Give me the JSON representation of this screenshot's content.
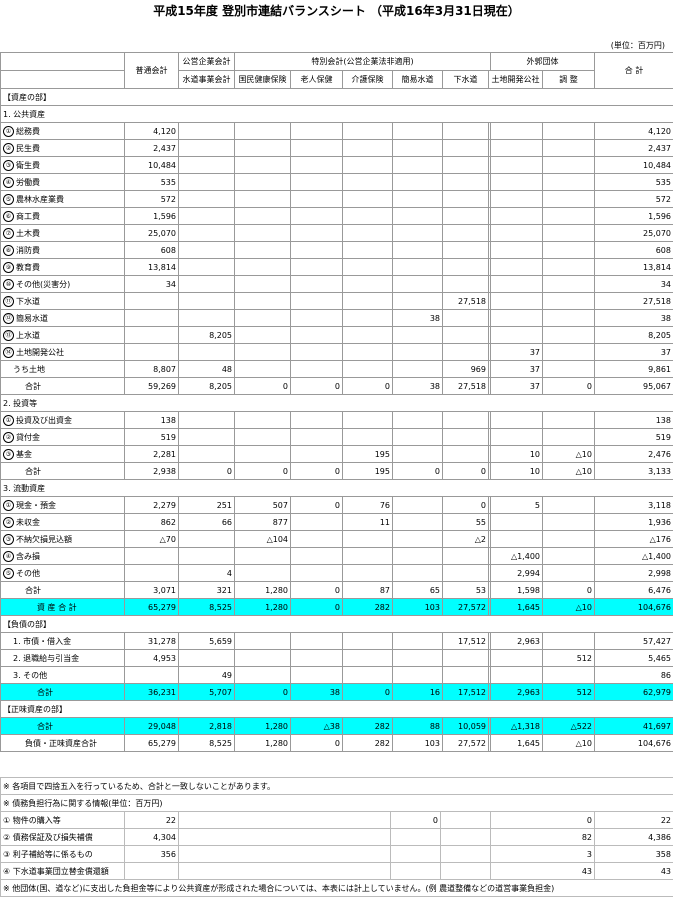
{
  "title": "平成15年度 登別市連結バランスシート （平成16年3月31日現在）",
  "unit": "(単位：百万円)",
  "headers": {
    "group_kouei": "公営企業会計",
    "group_tokubetsu": "特別会計(公営企業法非適用)",
    "group_gaibu": "外郭団体",
    "ippan": "普通会計",
    "suido": "水道事業会計",
    "kokuho": "国民健康保険",
    "rojin": "老人保健",
    "kaigo": "介護保険",
    "kani": "簡易水道",
    "gesui": "下水道",
    "tochi": "土地開発公社",
    "chosei": "調 整",
    "total": "合 計"
  },
  "rows": [
    {
      "type": "section",
      "label": "【資産の部】"
    },
    {
      "type": "section",
      "label": "1. 公共資産"
    },
    {
      "type": "item",
      "num": "①",
      "label": "総務費",
      "v": [
        "4,120",
        "",
        "",
        "",
        "",
        "",
        "",
        "",
        "",
        "",
        "4,120"
      ]
    },
    {
      "type": "item",
      "num": "②",
      "label": "民生費",
      "v": [
        "2,437",
        "",
        "",
        "",
        "",
        "",
        "",
        "",
        "",
        "",
        "2,437"
      ]
    },
    {
      "type": "item",
      "num": "③",
      "label": "衛生費",
      "v": [
        "10,484",
        "",
        "",
        "",
        "",
        "",
        "",
        "",
        "",
        "",
        "10,484"
      ]
    },
    {
      "type": "item",
      "num": "④",
      "label": "労働費",
      "v": [
        "535",
        "",
        "",
        "",
        "",
        "",
        "",
        "",
        "",
        "",
        "535"
      ]
    },
    {
      "type": "item",
      "num": "⑤",
      "label": "農林水産業費",
      "v": [
        "572",
        "",
        "",
        "",
        "",
        "",
        "",
        "",
        "",
        "",
        "572"
      ]
    },
    {
      "type": "item",
      "num": "⑥",
      "label": "商工費",
      "v": [
        "1,596",
        "",
        "",
        "",
        "",
        "",
        "",
        "",
        "",
        "",
        "1,596"
      ]
    },
    {
      "type": "item",
      "num": "⑦",
      "label": "土木費",
      "v": [
        "25,070",
        "",
        "",
        "",
        "",
        "",
        "",
        "",
        "",
        "",
        "25,070"
      ]
    },
    {
      "type": "item",
      "num": "⑧",
      "label": "消防費",
      "v": [
        "608",
        "",
        "",
        "",
        "",
        "",
        "",
        "",
        "",
        "",
        "608"
      ]
    },
    {
      "type": "item",
      "num": "⑨",
      "label": "教育費",
      "v": [
        "13,814",
        "",
        "",
        "",
        "",
        "",
        "",
        "",
        "",
        "",
        "13,814"
      ]
    },
    {
      "type": "item",
      "num": "⑩",
      "label": "その他(災害分)",
      "v": [
        "34",
        "",
        "",
        "",
        "",
        "",
        "",
        "",
        "",
        "",
        "34"
      ]
    },
    {
      "type": "item",
      "num": "⑪",
      "label": "下水道",
      "v": [
        "",
        "",
        "",
        "",
        "",
        "",
        "27,518",
        "",
        "",
        "",
        "27,518"
      ]
    },
    {
      "type": "item",
      "num": "⑫",
      "label": "簡易水道",
      "v": [
        "",
        "",
        "",
        "",
        "",
        "38",
        "",
        "",
        "",
        "",
        "38"
      ]
    },
    {
      "type": "item",
      "num": "⑬",
      "label": "上水道",
      "v": [
        "",
        "8,205",
        "",
        "",
        "",
        "",
        "",
        "",
        "",
        "",
        "8,205"
      ]
    },
    {
      "type": "item",
      "num": "⑭",
      "label": "土地開発公社",
      "v": [
        "",
        "",
        "",
        "",
        "",
        "",
        "",
        "",
        "37",
        "",
        "37"
      ]
    },
    {
      "type": "item",
      "num": "",
      "label": "うち土地",
      "v": [
        "8,807",
        "48",
        "",
        "",
        "",
        "",
        "969",
        "",
        "37",
        "",
        "9,861"
      ]
    },
    {
      "type": "sum",
      "label": "合計",
      "v": [
        "59,269",
        "8,205",
        "0",
        "0",
        "0",
        "38",
        "27,518",
        "",
        "37",
        "0",
        "95,067"
      ]
    },
    {
      "type": "section",
      "label": "2. 投資等"
    },
    {
      "type": "item",
      "num": "①",
      "label": "投資及び出資金",
      "v": [
        "138",
        "",
        "",
        "",
        "",
        "",
        "",
        "",
        "",
        "",
        "138"
      ]
    },
    {
      "type": "item",
      "num": "②",
      "label": "貸付金",
      "v": [
        "519",
        "",
        "",
        "",
        "",
        "",
        "",
        "",
        "",
        "",
        "519"
      ]
    },
    {
      "type": "item",
      "num": "③",
      "label": "基金",
      "v": [
        "2,281",
        "",
        "",
        "",
        "195",
        "",
        "",
        "",
        "10",
        "△10",
        "2,476"
      ]
    },
    {
      "type": "sum",
      "label": "合計",
      "v": [
        "2,938",
        "0",
        "0",
        "0",
        "195",
        "0",
        "0",
        "",
        "10",
        "△10",
        "3,133"
      ]
    },
    {
      "type": "section",
      "label": "3. 流動資産"
    },
    {
      "type": "item",
      "num": "①",
      "label": "現金・預金",
      "v": [
        "2,279",
        "251",
        "507",
        "0",
        "76",
        "",
        "0",
        "",
        "5",
        "",
        "3,118"
      ]
    },
    {
      "type": "item",
      "num": "②",
      "label": "未収金",
      "v": [
        "862",
        "66",
        "877",
        "",
        "11",
        "",
        "55",
        "",
        "",
        "",
        "1,936"
      ]
    },
    {
      "type": "item",
      "num": "③",
      "label": "不納欠損見込額",
      "v": [
        "△70",
        "",
        "△104",
        "",
        "",
        "",
        "△2",
        "",
        "",
        "",
        "△176"
      ]
    },
    {
      "type": "item",
      "num": "④",
      "label": "含み損",
      "v": [
        "",
        "",
        "",
        "",
        "",
        "",
        "",
        "",
        "△1,400",
        "",
        "△1,400"
      ]
    },
    {
      "type": "item",
      "num": "⑤",
      "label": "その他",
      "v": [
        "",
        "4",
        "",
        "",
        "",
        "",
        "",
        "",
        "2,994",
        "",
        "2,998"
      ]
    },
    {
      "type": "sum",
      "label": "合計",
      "v": [
        "3,071",
        "321",
        "1,280",
        "0",
        "87",
        "65",
        "53",
        "",
        "1,598",
        "0",
        "6,476"
      ]
    },
    {
      "type": "cyan",
      "label": "資 産 合 計",
      "v": [
        "65,279",
        "8,525",
        "1,280",
        "0",
        "282",
        "103",
        "27,572",
        "",
        "1,645",
        "△10",
        "104,676"
      ]
    },
    {
      "type": "section",
      "label": "【負債の部】"
    },
    {
      "type": "item",
      "num": "",
      "label": "1. 市債・借入金",
      "v": [
        "31,278",
        "5,659",
        "",
        "",
        "",
        "",
        "17,512",
        "",
        "2,963",
        "",
        "57,427"
      ]
    },
    {
      "type": "item",
      "num": "",
      "label": "2. 退職給与引当金",
      "v": [
        "4,953",
        "",
        "",
        "",
        "",
        "",
        "",
        "",
        "",
        "512",
        "5,465"
      ]
    },
    {
      "type": "item",
      "num": "",
      "label": "3. その他",
      "v": [
        "",
        "49",
        "",
        "",
        "",
        "",
        "",
        "",
        "",
        "",
        "86"
      ]
    },
    {
      "type": "cyan",
      "label": "合計",
      "v": [
        "36,231",
        "5,707",
        "0",
        "38",
        "0",
        "16",
        "17,512",
        "",
        "2,963",
        "512",
        "62,979"
      ]
    },
    {
      "type": "section",
      "label": "【正味資産の部】"
    },
    {
      "type": "cyan",
      "label": "合計",
      "v": [
        "29,048",
        "2,818",
        "1,280",
        "△38",
        "282",
        "88",
        "10,059",
        "",
        "△1,318",
        "△522",
        "41,697"
      ]
    },
    {
      "type": "sum",
      "label": "負債・正味資産合計",
      "v": [
        "65,279",
        "8,525",
        "1,280",
        "0",
        "282",
        "103",
        "27,572",
        "",
        "1,645",
        "△10",
        "104,676"
      ]
    }
  ],
  "notes": [
    {
      "label": "※ 各項目で四捨五入を行っているため、合計と一致しないことがあります。",
      "v": []
    },
    {
      "label": "※ 債務負担行為に関する情報(単位：百万円)",
      "v": []
    },
    {
      "label": "① 物件の購入等",
      "v": [
        "22",
        "",
        "0",
        "",
        "0",
        "22"
      ]
    },
    {
      "label": "② 債務保証及び損失補償",
      "v": [
        "4,304",
        "",
        "",
        "",
        "82",
        "4,386"
      ]
    },
    {
      "label": "③ 利子補給等に係るもの",
      "v": [
        "356",
        "",
        "",
        "",
        "3",
        "358"
      ]
    },
    {
      "label": "④ 下水道事業団立替金償還額",
      "v": [
        "",
        "",
        "",
        "",
        "43",
        "43"
      ]
    },
    {
      "label": "※ 他団体(国、道など)に支出した負担金等により公共資産が形成された場合については、本表には計上していません。(例 農道整備などの道営事業負担金)",
      "v": []
    }
  ]
}
